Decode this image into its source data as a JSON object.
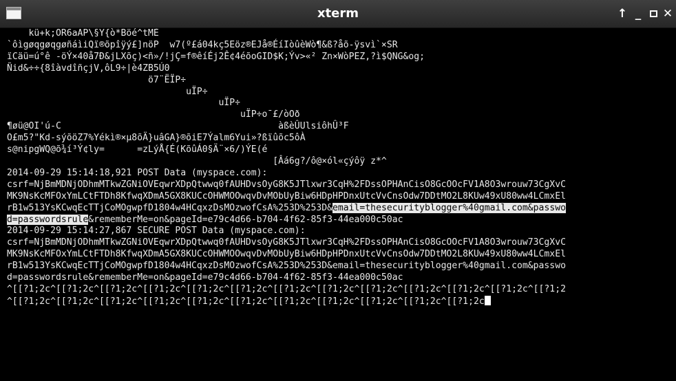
{
  "window": {
    "title": "xterm",
    "controls": {
      "up": "↑",
      "minimize": "_",
      "close": "✕"
    }
  },
  "terminal": {
    "lines": [
      "    kü+k;OR6aAP\\§Y{ò*Böé^tMÈ",
      "`ôìgøqgøqgøñáìiQï®õpîÿý£]nöP  w7(º£á04kç5Eöz®EJå®ÉíIòûèWò¶&ß?åõ-ÿsvì`×SR",
      "ïCäü=ú°ê -öÝ×40å7Ð&jLXõç)<ñ»/!jÇ=f®êíÉj2Ê¢4éõoGID$K;Ýv>«² Zn×WòPEZ,?ì$QNG&og;",
      "Ñid&÷÷{8îàvdîñçjV,ôL9÷|è4ZB5Ú0",
      "                          ö7¨ËÏP÷",
      "                                 uÏP÷",
      "                                       uÏP÷",
      "                                           uÏP÷o¯£/òOð",
      "¶øü@OI'ú-C                                        àßèÛUlsiôhÛ³F",
      "O£m5?\"Kd-sýõöZ7%Yékì®×µ8õÄ}uâGA}®õiE7Ýalm6Yui»?ßïûõc5ôÀ",
      "s@nipgWQ@õ¾í³Ý¢ly=      =zLýÅ{É(KõûÁ0§Ä¨×6/)ÝE(é",
      "",
      "                                                 [Âá6g?/ô@×ól«çýôÿ z*^",
      "2014-09-29 15:14:18,921 POST Data (myspace.com):",
      "csrf=NjBmMDNjODhmMTkwZGNiOVEqwrXDpQtwwq0fAUHDvsOyG8K5JTlxwr3CqH%2FDssOPHAnCisO8GcOOcFV1A8O3wrouw73CgXvC",
      "MK9NsKcMFOxYmLCtFTDh8KfwqXDmA5GX8KUCcOHWMOOwqvDvMObUyBiw6HDpHPDnxUtcVvCnsOdw7DDtMO2L8KUw49xU80ww4LCmxEl",
      "rB1w513YsKCwqEcTTjCoMOgwpfD1804w4HCqxzDsMOzwofCsA%253D%253D&",
      "d=passwordsrule",
      "2014-09-29 15:14:27,867 SECURE POST Data (myspace.com):",
      "csrf=NjBmMDNjODhmMTkwZGNiOVEqwrXDpQtwwq0fAUHDvsOyG8K5JTlxwr3CqH%2FDssOPHAnCisO8GcOOcFV1A8O3wrouw73CgXvC",
      "MK9NsKcMFOxYmLCtFTDh8KfwqXDmA5GX8KUCcOHWMOOwqvDvMObUyBiw6HDpHPDnxUtcVvCnsOdw7DDtMO2L8KUw49xU80ww4LCmxEl",
      "rB1w513YsKCwqEcTTjCoMOgwpfD1804w4HCqxzDsMOzwofCsA%253D%253D&email=thesecurityblogger%40gmail.com&passwo",
      "d=passwordsrule&rememberMe=on&pageId=e79c4d66-b704-4f62-85f3-44ea000c50ac",
      "^[[?1;2c^[[?1;2c^[[?1;2c^[[?1;2c^[[?1;2c^[[?1;2c^[[?1;2c^[[?1;2c^[[?1;2c^[[?1;2c^[[?1;2c^[[?1;2c^[[?1;2",
      "^[[?1;2c^[[?1;2c^[[?1;2c^[[?1;2c^[[?1;2c^[[?1;2c^[[?1;2c^[[?1;2c^[[?1;2c^[[?1;2c^[[?1;2c"
    ],
    "highlight": {
      "line17": "email=thesecurityblogger%40gmail.com&passwo",
      "line18_tail": "&rememberMe=on&pageId=e79c4d66-b704-4f62-85f3-44ea000c50ac"
    }
  }
}
